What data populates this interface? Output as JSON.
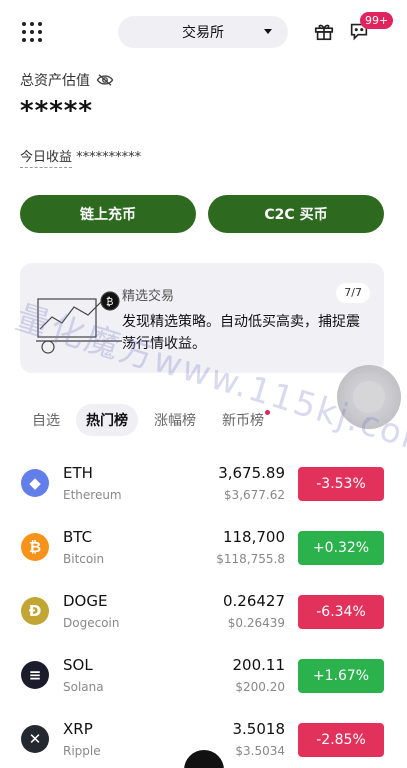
{
  "header": {
    "exchange_label": "交易所",
    "message_badge": "99+"
  },
  "assets": {
    "label": "总资产估值",
    "value": "*****",
    "earnings_label": "今日收益",
    "earnings_value": "**********"
  },
  "actions": {
    "deposit_label": "链上充币",
    "c2c_label": "C2C 买币"
  },
  "promo": {
    "title": "精选交易",
    "page": "7/7",
    "description": "发现精选策略。自动低买高卖，捕捉震荡行情收益。"
  },
  "tabs": [
    {
      "label": "自选"
    },
    {
      "label": "热门榜",
      "active": true
    },
    {
      "label": "涨幅榜"
    },
    {
      "label": "新币榜"
    }
  ],
  "coins": [
    {
      "symbol": "ETH",
      "name": "Ethereum",
      "price": "3,675.89",
      "usd": "$3,677.62",
      "change": "-3.53%",
      "dir": "down",
      "logo_color": "#627eea",
      "logo_char": "◆",
      "icon": "eth-icon"
    },
    {
      "symbol": "BTC",
      "name": "Bitcoin",
      "price": "118,700",
      "usd": "$118,755.8",
      "change": "+0.32%",
      "dir": "up",
      "logo_color": "#f7931a",
      "logo_char": "₿",
      "icon": "btc-icon"
    },
    {
      "symbol": "DOGE",
      "name": "Dogecoin",
      "price": "0.26427",
      "usd": "$0.26439",
      "change": "-6.34%",
      "dir": "down",
      "logo_color": "#c2a633",
      "logo_char": "Ð",
      "icon": "doge-icon"
    },
    {
      "symbol": "SOL",
      "name": "Solana",
      "price": "200.11",
      "usd": "$200.20",
      "change": "+1.67%",
      "dir": "up",
      "logo_color": "#1b1b2b",
      "logo_char": "≡",
      "icon": "sol-icon"
    },
    {
      "symbol": "XRP",
      "name": "Ripple",
      "price": "3.5018",
      "usd": "$3.5034",
      "change": "-2.85%",
      "dir": "down",
      "logo_color": "#23292f",
      "logo_char": "✕",
      "icon": "xrp-icon"
    }
  ],
  "watermark": "量化魔方www.115kj.com",
  "colors": {
    "primary_green": "#2d6a1f",
    "up": "#2bb24c",
    "down": "#e2325c",
    "badge": "#e0245e"
  }
}
